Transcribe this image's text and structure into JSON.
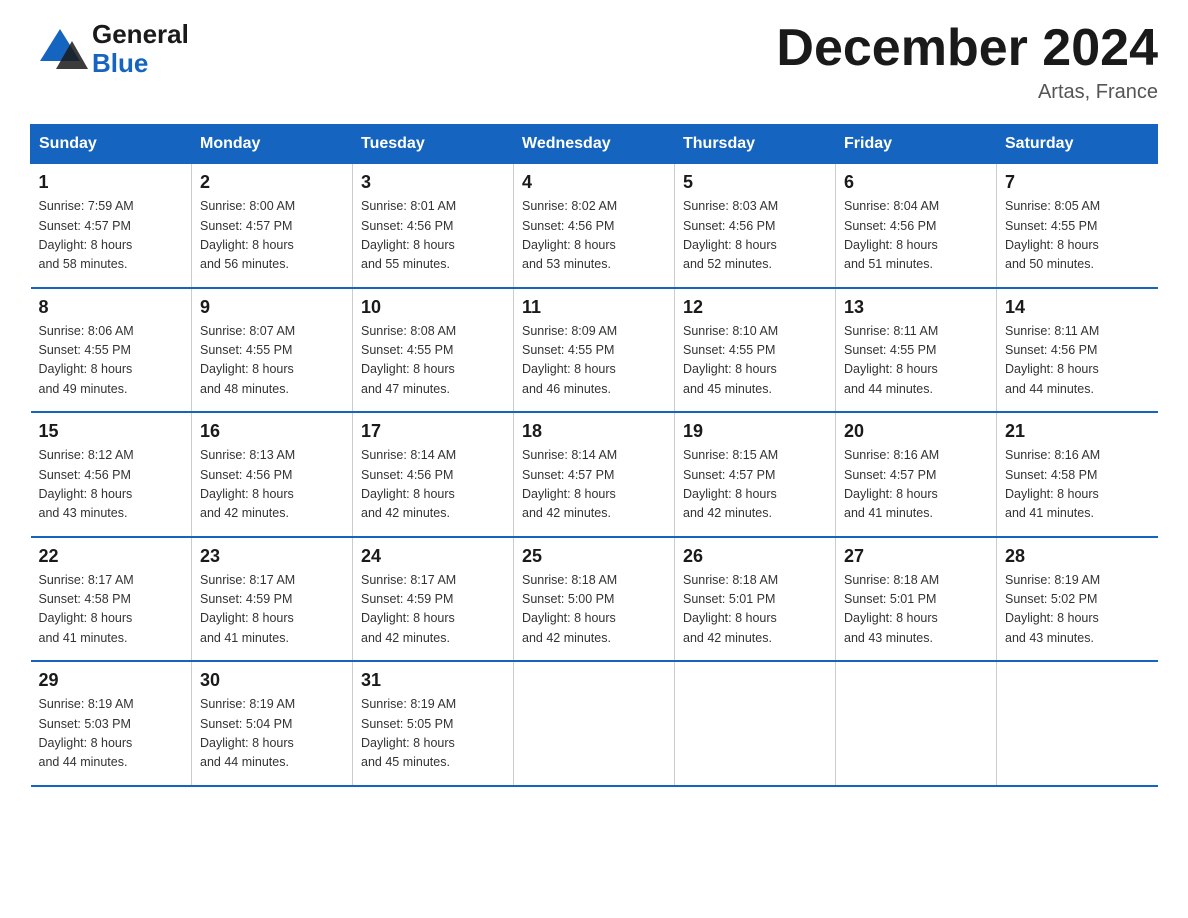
{
  "header": {
    "title": "December 2024",
    "location": "Artas, France",
    "logo_general": "General",
    "logo_blue": "Blue"
  },
  "days_of_week": [
    "Sunday",
    "Monday",
    "Tuesday",
    "Wednesday",
    "Thursday",
    "Friday",
    "Saturday"
  ],
  "weeks": [
    [
      {
        "day": "1",
        "sunrise": "Sunrise: 7:59 AM",
        "sunset": "Sunset: 4:57 PM",
        "daylight": "Daylight: 8 hours",
        "minutes": "and 58 minutes."
      },
      {
        "day": "2",
        "sunrise": "Sunrise: 8:00 AM",
        "sunset": "Sunset: 4:57 PM",
        "daylight": "Daylight: 8 hours",
        "minutes": "and 56 minutes."
      },
      {
        "day": "3",
        "sunrise": "Sunrise: 8:01 AM",
        "sunset": "Sunset: 4:56 PM",
        "daylight": "Daylight: 8 hours",
        "minutes": "and 55 minutes."
      },
      {
        "day": "4",
        "sunrise": "Sunrise: 8:02 AM",
        "sunset": "Sunset: 4:56 PM",
        "daylight": "Daylight: 8 hours",
        "minutes": "and 53 minutes."
      },
      {
        "day": "5",
        "sunrise": "Sunrise: 8:03 AM",
        "sunset": "Sunset: 4:56 PM",
        "daylight": "Daylight: 8 hours",
        "minutes": "and 52 minutes."
      },
      {
        "day": "6",
        "sunrise": "Sunrise: 8:04 AM",
        "sunset": "Sunset: 4:56 PM",
        "daylight": "Daylight: 8 hours",
        "minutes": "and 51 minutes."
      },
      {
        "day": "7",
        "sunrise": "Sunrise: 8:05 AM",
        "sunset": "Sunset: 4:55 PM",
        "daylight": "Daylight: 8 hours",
        "minutes": "and 50 minutes."
      }
    ],
    [
      {
        "day": "8",
        "sunrise": "Sunrise: 8:06 AM",
        "sunset": "Sunset: 4:55 PM",
        "daylight": "Daylight: 8 hours",
        "minutes": "and 49 minutes."
      },
      {
        "day": "9",
        "sunrise": "Sunrise: 8:07 AM",
        "sunset": "Sunset: 4:55 PM",
        "daylight": "Daylight: 8 hours",
        "minutes": "and 48 minutes."
      },
      {
        "day": "10",
        "sunrise": "Sunrise: 8:08 AM",
        "sunset": "Sunset: 4:55 PM",
        "daylight": "Daylight: 8 hours",
        "minutes": "and 47 minutes."
      },
      {
        "day": "11",
        "sunrise": "Sunrise: 8:09 AM",
        "sunset": "Sunset: 4:55 PM",
        "daylight": "Daylight: 8 hours",
        "minutes": "and 46 minutes."
      },
      {
        "day": "12",
        "sunrise": "Sunrise: 8:10 AM",
        "sunset": "Sunset: 4:55 PM",
        "daylight": "Daylight: 8 hours",
        "minutes": "and 45 minutes."
      },
      {
        "day": "13",
        "sunrise": "Sunrise: 8:11 AM",
        "sunset": "Sunset: 4:55 PM",
        "daylight": "Daylight: 8 hours",
        "minutes": "and 44 minutes."
      },
      {
        "day": "14",
        "sunrise": "Sunrise: 8:11 AM",
        "sunset": "Sunset: 4:56 PM",
        "daylight": "Daylight: 8 hours",
        "minutes": "and 44 minutes."
      }
    ],
    [
      {
        "day": "15",
        "sunrise": "Sunrise: 8:12 AM",
        "sunset": "Sunset: 4:56 PM",
        "daylight": "Daylight: 8 hours",
        "minutes": "and 43 minutes."
      },
      {
        "day": "16",
        "sunrise": "Sunrise: 8:13 AM",
        "sunset": "Sunset: 4:56 PM",
        "daylight": "Daylight: 8 hours",
        "minutes": "and 42 minutes."
      },
      {
        "day": "17",
        "sunrise": "Sunrise: 8:14 AM",
        "sunset": "Sunset: 4:56 PM",
        "daylight": "Daylight: 8 hours",
        "minutes": "and 42 minutes."
      },
      {
        "day": "18",
        "sunrise": "Sunrise: 8:14 AM",
        "sunset": "Sunset: 4:57 PM",
        "daylight": "Daylight: 8 hours",
        "minutes": "and 42 minutes."
      },
      {
        "day": "19",
        "sunrise": "Sunrise: 8:15 AM",
        "sunset": "Sunset: 4:57 PM",
        "daylight": "Daylight: 8 hours",
        "minutes": "and 42 minutes."
      },
      {
        "day": "20",
        "sunrise": "Sunrise: 8:16 AM",
        "sunset": "Sunset: 4:57 PM",
        "daylight": "Daylight: 8 hours",
        "minutes": "and 41 minutes."
      },
      {
        "day": "21",
        "sunrise": "Sunrise: 8:16 AM",
        "sunset": "Sunset: 4:58 PM",
        "daylight": "Daylight: 8 hours",
        "minutes": "and 41 minutes."
      }
    ],
    [
      {
        "day": "22",
        "sunrise": "Sunrise: 8:17 AM",
        "sunset": "Sunset: 4:58 PM",
        "daylight": "Daylight: 8 hours",
        "minutes": "and 41 minutes."
      },
      {
        "day": "23",
        "sunrise": "Sunrise: 8:17 AM",
        "sunset": "Sunset: 4:59 PM",
        "daylight": "Daylight: 8 hours",
        "minutes": "and 41 minutes."
      },
      {
        "day": "24",
        "sunrise": "Sunrise: 8:17 AM",
        "sunset": "Sunset: 4:59 PM",
        "daylight": "Daylight: 8 hours",
        "minutes": "and 42 minutes."
      },
      {
        "day": "25",
        "sunrise": "Sunrise: 8:18 AM",
        "sunset": "Sunset: 5:00 PM",
        "daylight": "Daylight: 8 hours",
        "minutes": "and 42 minutes."
      },
      {
        "day": "26",
        "sunrise": "Sunrise: 8:18 AM",
        "sunset": "Sunset: 5:01 PM",
        "daylight": "Daylight: 8 hours",
        "minutes": "and 42 minutes."
      },
      {
        "day": "27",
        "sunrise": "Sunrise: 8:18 AM",
        "sunset": "Sunset: 5:01 PM",
        "daylight": "Daylight: 8 hours",
        "minutes": "and 43 minutes."
      },
      {
        "day": "28",
        "sunrise": "Sunrise: 8:19 AM",
        "sunset": "Sunset: 5:02 PM",
        "daylight": "Daylight: 8 hours",
        "minutes": "and 43 minutes."
      }
    ],
    [
      {
        "day": "29",
        "sunrise": "Sunrise: 8:19 AM",
        "sunset": "Sunset: 5:03 PM",
        "daylight": "Daylight: 8 hours",
        "minutes": "and 44 minutes."
      },
      {
        "day": "30",
        "sunrise": "Sunrise: 8:19 AM",
        "sunset": "Sunset: 5:04 PM",
        "daylight": "Daylight: 8 hours",
        "minutes": "and 44 minutes."
      },
      {
        "day": "31",
        "sunrise": "Sunrise: 8:19 AM",
        "sunset": "Sunset: 5:05 PM",
        "daylight": "Daylight: 8 hours",
        "minutes": "and 45 minutes."
      },
      null,
      null,
      null,
      null
    ]
  ],
  "colors": {
    "header_bg": "#1565c0",
    "border": "#1565c0",
    "text_dark": "#1a1a1a",
    "text_light": "#ffffff",
    "logo_blue": "#1565c0"
  }
}
